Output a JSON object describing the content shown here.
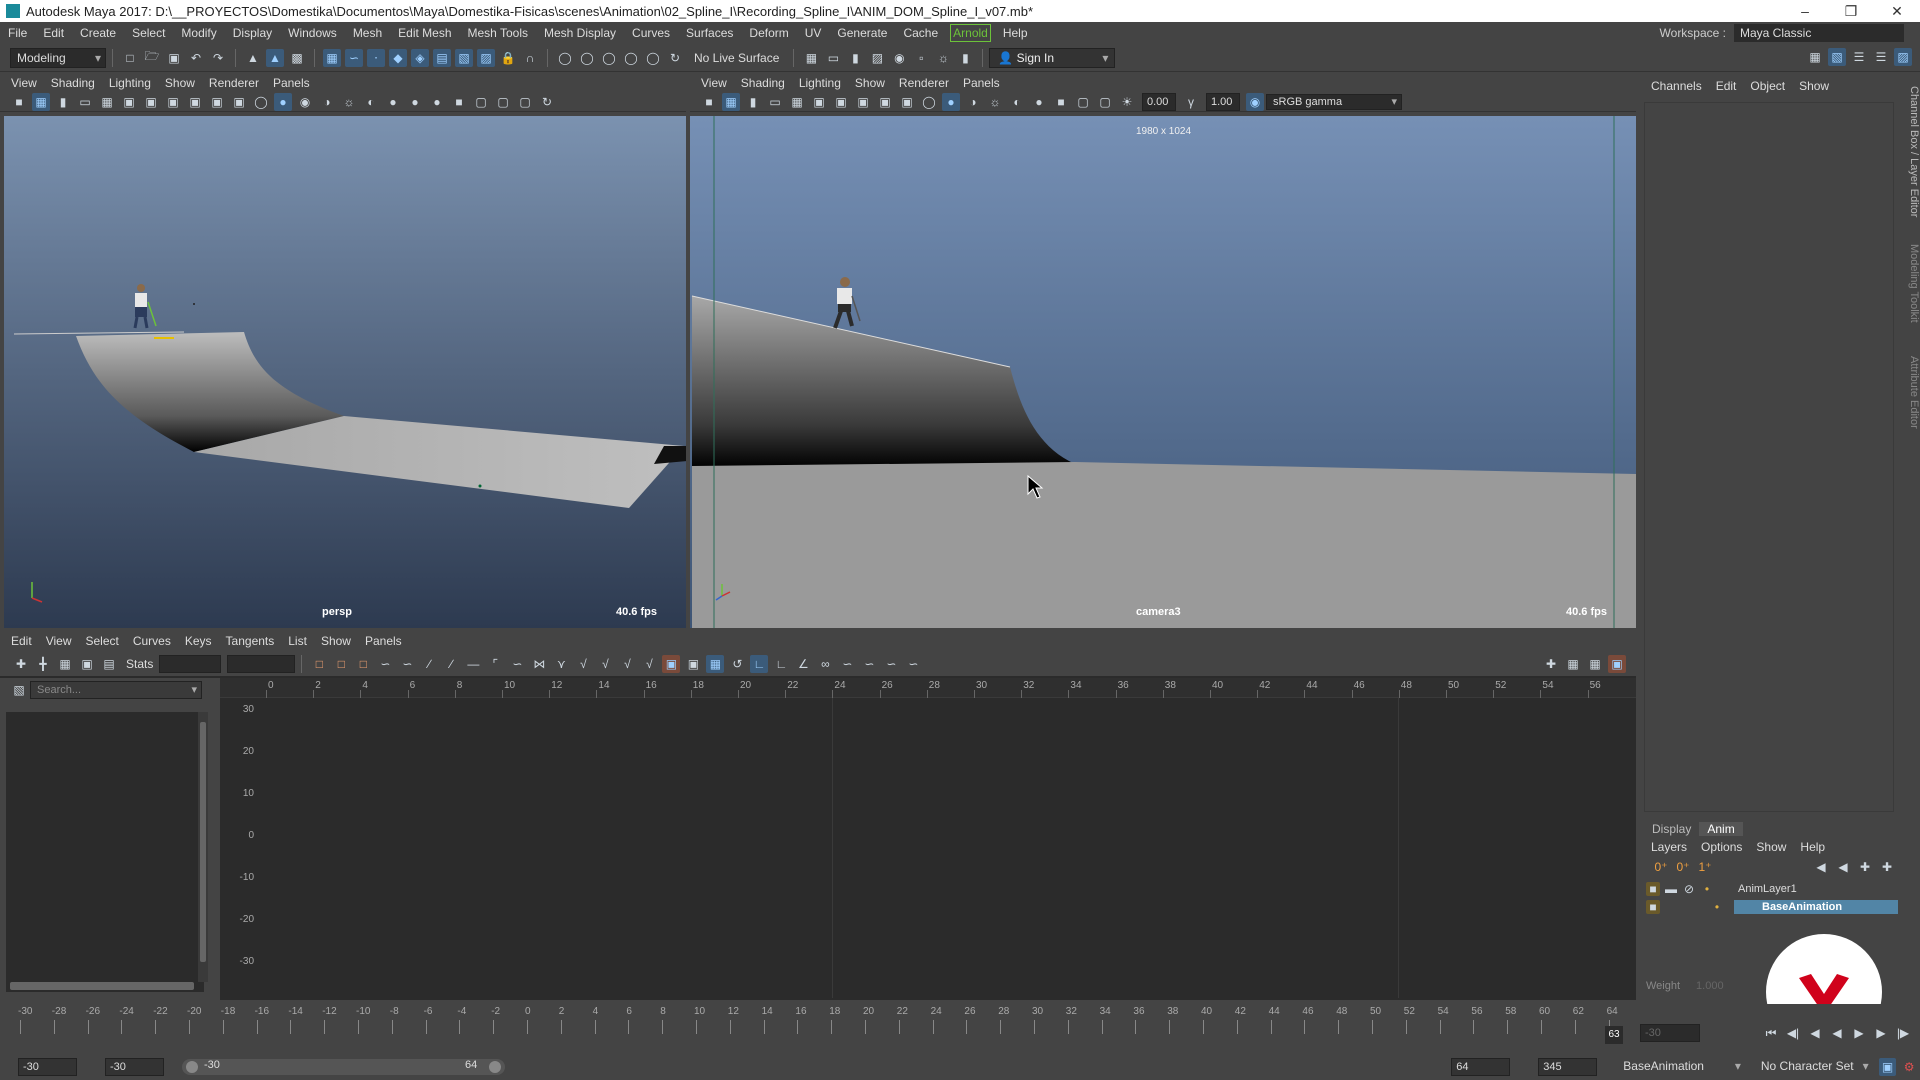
{
  "window": {
    "title": "Autodesk Maya 2017: D:\\__PROYECTOS\\Domestika\\Documentos\\Maya\\Domestika-Fisicas\\scenes\\Animation\\02_Spline_I\\Recording_Spline_I\\ANIM_DOM_Spline_I_v07.mb*"
  },
  "menubar": {
    "items": [
      "File",
      "Edit",
      "Create",
      "Select",
      "Modify",
      "Display",
      "Windows",
      "Mesh",
      "Edit Mesh",
      "Mesh Tools",
      "Mesh Display",
      "Curves",
      "Surfaces",
      "Deform",
      "UV",
      "Generate",
      "Cache"
    ],
    "arnold": "Arnold",
    "help": "Help",
    "workspace_label": "Workspace :",
    "workspace_value": "Maya Classic"
  },
  "shelf": {
    "mode": "Modeling",
    "live_surface": "No Live Surface",
    "sign_in": "Sign In"
  },
  "viewport_left": {
    "menu": [
      "View",
      "Shading",
      "Lighting",
      "Show",
      "Renderer",
      "Panels"
    ],
    "camera": "persp",
    "fps": "40.6 fps"
  },
  "viewport_right": {
    "menu": [
      "View",
      "Shading",
      "Lighting",
      "Show",
      "Renderer",
      "Panels"
    ],
    "camera": "camera3",
    "fps": "40.6 fps",
    "resolution": "1980 x 1024",
    "exposure": "0.00",
    "gamma": "1.00",
    "color_space": "sRGB gamma"
  },
  "channel_box": {
    "menu": [
      "Channels",
      "Edit",
      "Object",
      "Show"
    ]
  },
  "side_tabs": [
    "Channel Box / Layer Editor",
    "Modeling Toolkit",
    "Attribute Editor"
  ],
  "graph_editor": {
    "menu": [
      "Edit",
      "View",
      "Select",
      "Curves",
      "Keys",
      "Tangents",
      "List",
      "Show",
      "Panels"
    ],
    "stats_label": "Stats",
    "search_placeholder": "Search...",
    "x_ticks": [
      "0",
      "2",
      "4",
      "6",
      "8",
      "10",
      "12",
      "14",
      "16",
      "18",
      "20",
      "22",
      "24",
      "26",
      "28",
      "30",
      "32",
      "34",
      "36",
      "38",
      "40",
      "42",
      "44",
      "46",
      "48",
      "50",
      "52",
      "54",
      "56"
    ],
    "y_ticks": [
      "30",
      "20",
      "10",
      "0",
      "-10",
      "-20",
      "-30"
    ]
  },
  "layer_editor": {
    "tabs": [
      "Display",
      "Anim"
    ],
    "active_tab": "Anim",
    "menu": [
      "Layers",
      "Options",
      "Show",
      "Help"
    ],
    "layers": [
      "AnimLayer1",
      "BaseAnimation"
    ],
    "selected_layer": "BaseAnimation",
    "weight_label": "Weight",
    "weight_value": "1.000"
  },
  "time_slider": {
    "ticks": [
      "-30",
      "-28",
      "-26",
      "-24",
      "-22",
      "-20",
      "-18",
      "-16",
      "-14",
      "-12",
      "-10",
      "-8",
      "-6",
      "-4",
      "-2",
      "0",
      "2",
      "4",
      "6",
      "8",
      "10",
      "12",
      "14",
      "16",
      "18",
      "20",
      "22",
      "24",
      "26",
      "28",
      "30",
      "32",
      "34",
      "36",
      "38",
      "40",
      "42",
      "44",
      "46",
      "48",
      "50",
      "52",
      "54",
      "56",
      "58",
      "60",
      "62",
      "64"
    ],
    "current_frame": "63",
    "current_field": "-30"
  },
  "range_bar": {
    "start": "-30",
    "anim_start": "-30",
    "range_start": "-30",
    "range_end": "64",
    "anim_end": "64",
    "end": "345",
    "anim_layer": "BaseAnimation",
    "character_set": "No Character Set"
  },
  "colors": {
    "accent": "#5285a6",
    "arnold": "#6cc23a",
    "badge": "#d0021b"
  }
}
